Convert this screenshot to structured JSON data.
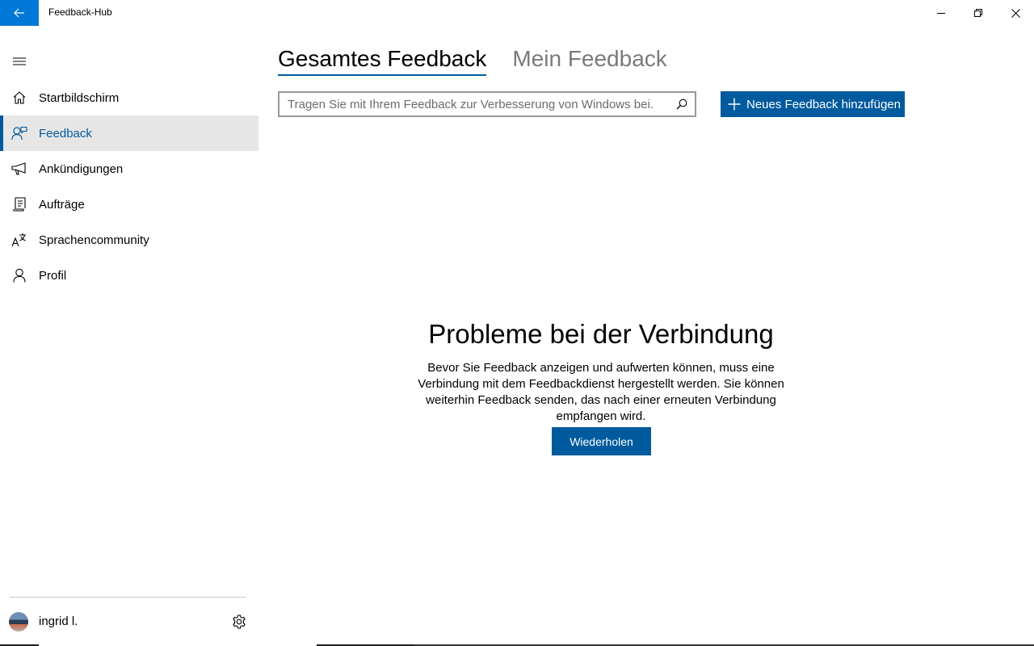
{
  "window": {
    "title": "Feedback-Hub",
    "accent": "#0078d7"
  },
  "sidebar": {
    "items": [
      {
        "label": "Startbildschirm",
        "icon": "home-icon",
        "active": false
      },
      {
        "label": "Feedback",
        "icon": "feedback-icon",
        "active": true
      },
      {
        "label": "Ankündigungen",
        "icon": "megaphone-icon",
        "active": false
      },
      {
        "label": "Aufträge",
        "icon": "quests-icon",
        "active": false
      },
      {
        "label": "Sprachencommunity",
        "icon": "language-icon",
        "active": false
      },
      {
        "label": "Profil",
        "icon": "person-icon",
        "active": false
      }
    ],
    "user": {
      "name": "ingrid l."
    }
  },
  "main": {
    "tabs": [
      {
        "label": "Gesamtes Feedback",
        "active": true
      },
      {
        "label": "Mein Feedback",
        "active": false
      }
    ],
    "search": {
      "placeholder": "Tragen Sie mit Ihrem Feedback zur Verbesserung von Windows bei.",
      "value": ""
    },
    "add_button": "Neues Feedback hinzufügen",
    "error": {
      "title": "Probleme bei der Verbindung",
      "message": "Bevor Sie Feedback anzeigen und aufwerten können, muss eine Verbindung mit dem Feedbackdienst hergestellt werden. Sie können weiterhin Feedback senden, das nach einer erneuten Verbindung empfangen wird.",
      "retry_label": "Wiederholen"
    }
  },
  "colors": {
    "primary": "#005a9e",
    "active_bg": "#e6e6e6"
  }
}
